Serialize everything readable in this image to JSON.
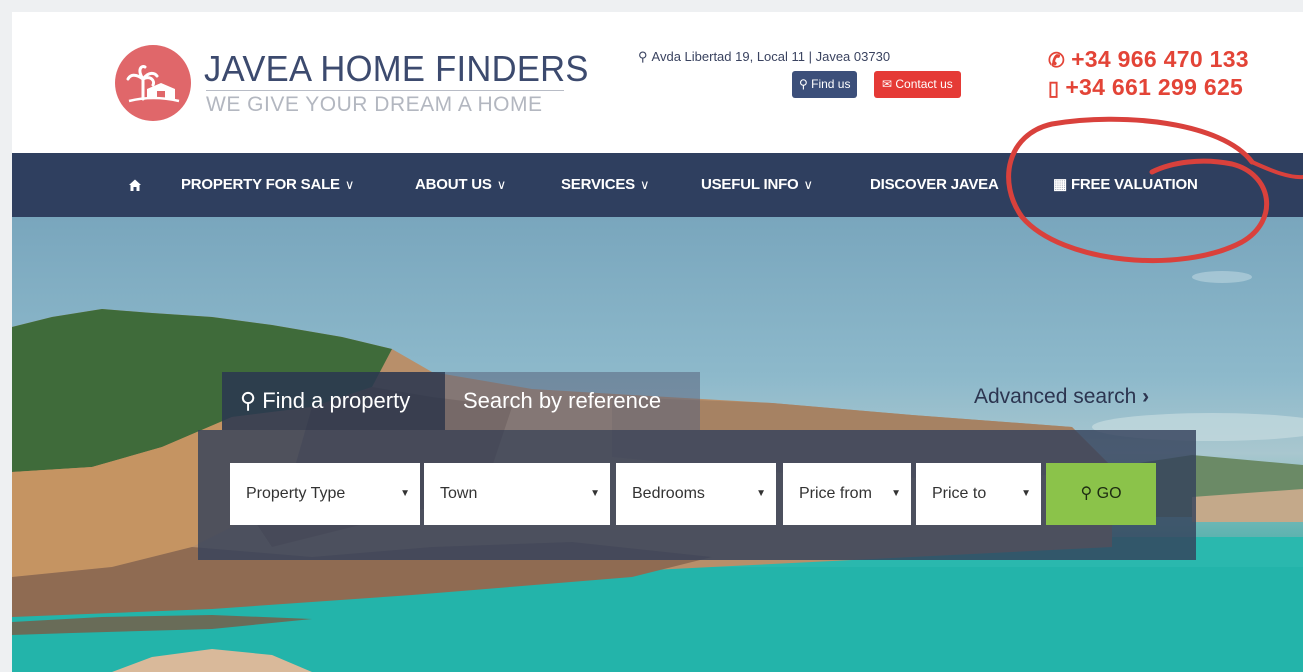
{
  "brand": {
    "name": "JAVEA HOME FINDERS",
    "tagline": "WE GIVE YOUR DREAM A HOME",
    "logo_color": "#e0676a"
  },
  "contact": {
    "address": "Avda Libertad 19, Local 11 | Javea 03730",
    "find_us_label": "Find us",
    "contact_us_label": "Contact us",
    "phone_landline": "+34 966 470 133",
    "phone_mobile": "+34 661 299 625"
  },
  "nav": {
    "home_icon": "home-icon",
    "items": [
      {
        "label": "PROPERTY FOR SALE"
      },
      {
        "label": "ABOUT US"
      },
      {
        "label": "SERVICES"
      },
      {
        "label": "USEFUL INFO"
      },
      {
        "label": "DISCOVER JAVEA"
      },
      {
        "label": "FREE VALUATION"
      }
    ]
  },
  "search": {
    "tab_find": "Find a property",
    "tab_reference": "Search by reference",
    "advanced": "Advanced search",
    "fields": {
      "property_type": "Property Type",
      "town": "Town",
      "bedrooms": "Bedrooms",
      "price_from": "Price from",
      "price_to": "Price to"
    },
    "go_label": "GO"
  },
  "colors": {
    "nav_bg": "#2f3f5f",
    "phone": "#e34437",
    "go_button": "#8bc34a",
    "annotation": "#d9413c"
  }
}
